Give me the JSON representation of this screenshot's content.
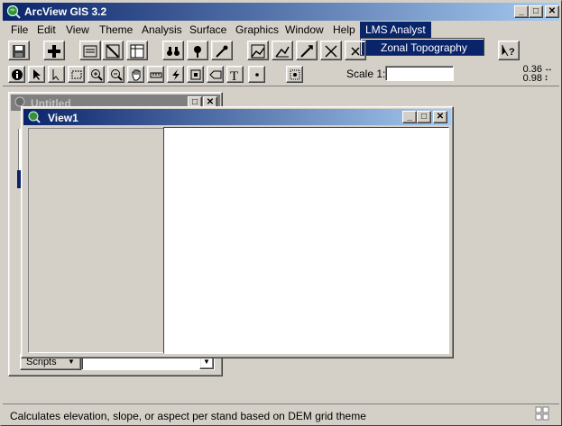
{
  "app": {
    "title": "ArcView GIS 3.2"
  },
  "menubar": {
    "items": [
      {
        "label": "File"
      },
      {
        "label": "Edit"
      },
      {
        "label": "View"
      },
      {
        "label": "Theme"
      },
      {
        "label": "Analysis"
      },
      {
        "label": "Surface"
      },
      {
        "label": "Graphics"
      },
      {
        "label": "Window"
      },
      {
        "label": "Help"
      },
      {
        "label": "LMS Analyst"
      }
    ]
  },
  "dropdown": {
    "items": [
      {
        "label": "Zonal Topography"
      }
    ]
  },
  "toolbar2": {
    "scale_label": "Scale 1:",
    "scale_value": ""
  },
  "coords": {
    "x": "0.36",
    "y": "0.98"
  },
  "project_window": {
    "title": "Untitled",
    "scripts_label": "Scripts"
  },
  "view_window": {
    "title": "View1"
  },
  "status": {
    "text": "Calculates elevation, slope, or aspect per stand based on DEM grid theme"
  },
  "colors": {
    "titlebar": "#0a246a",
    "titlebar_gradient_end": "#a6caf0",
    "face": "#d4d0c8"
  }
}
